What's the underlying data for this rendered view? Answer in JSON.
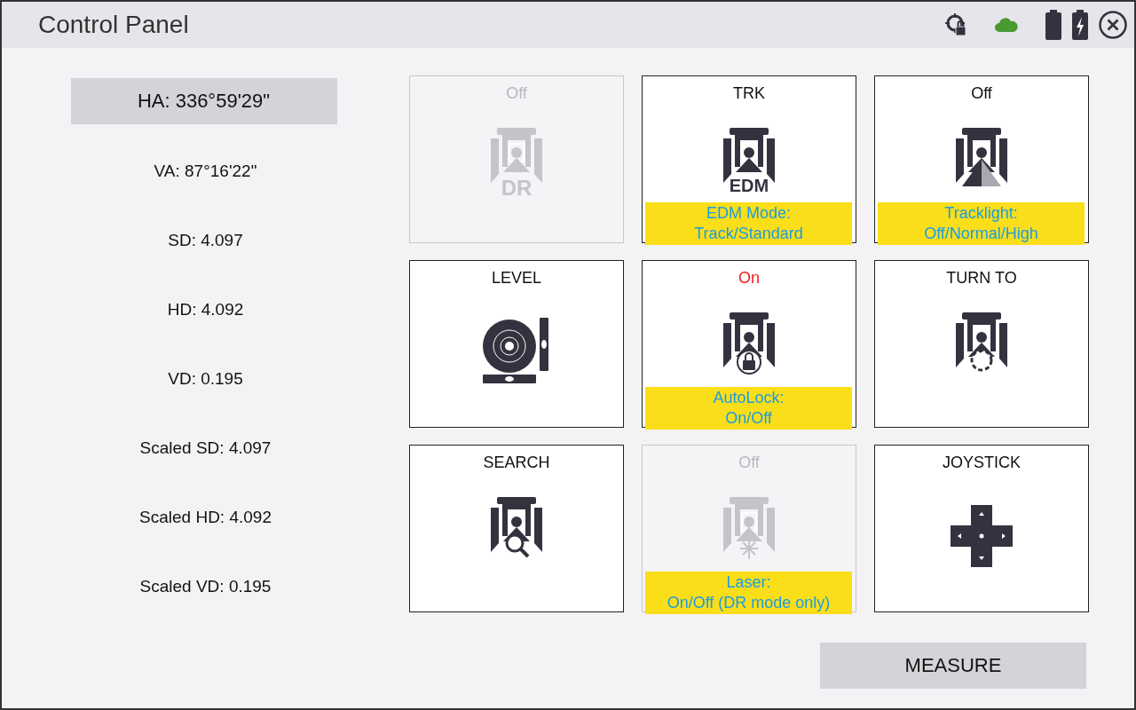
{
  "window": {
    "title": "Control Panel"
  },
  "primary_reading": "HA: 336°59'29\"",
  "readings": [
    "VA: 87°16'22\"",
    "SD: 4.097",
    "HD: 4.092",
    "VD: 0.195",
    "Scaled SD: 4.097",
    "Scaled HD: 4.092",
    "Scaled VD: 0.195"
  ],
  "tiles": [
    {
      "label": "Off",
      "kind": "dr",
      "disabled": true,
      "active": false,
      "icon_text": "DR"
    },
    {
      "label": "TRK",
      "kind": "edm",
      "disabled": false,
      "active": false,
      "icon_text": "EDM",
      "callout": [
        "EDM Mode:",
        "Track/Standard"
      ]
    },
    {
      "label": "Off",
      "kind": "tracklight",
      "disabled": false,
      "active": false,
      "callout": [
        "Tracklight:",
        "Off/Normal/High"
      ]
    },
    {
      "label": "LEVEL",
      "kind": "level",
      "disabled": false,
      "active": false
    },
    {
      "label": "On",
      "kind": "autolock",
      "disabled": false,
      "active": true,
      "callout": [
        "AutoLock:",
        "On/Off"
      ]
    },
    {
      "label": "TURN TO",
      "kind": "turnto",
      "disabled": false,
      "active": false
    },
    {
      "label": "SEARCH",
      "kind": "search",
      "disabled": false,
      "active": false
    },
    {
      "label": "Off",
      "kind": "laser",
      "disabled": true,
      "active": false,
      "callout": [
        "Laser:",
        "On/Off (DR mode only)"
      ]
    },
    {
      "label": "JOYSTICK",
      "kind": "joystick",
      "disabled": false,
      "active": false
    }
  ],
  "measure_button": "MEASURE"
}
